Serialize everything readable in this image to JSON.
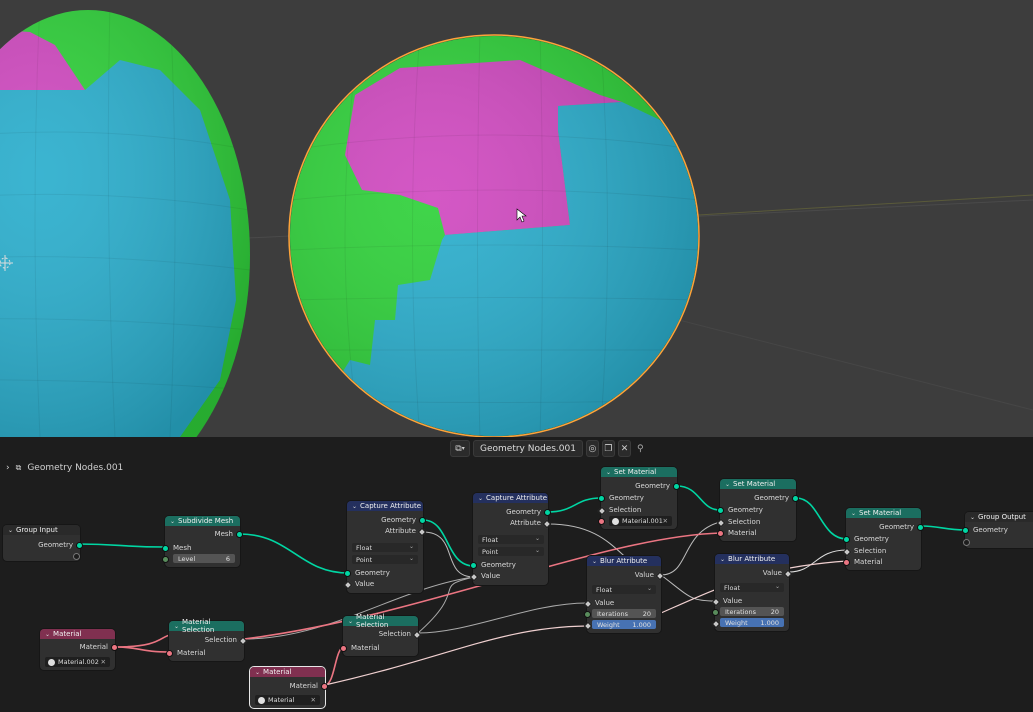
{
  "header": {
    "tree_name": "Geometry Nodes.001"
  },
  "breadcrumb": {
    "label": "Geometry Nodes.001"
  },
  "colors": {
    "geometry_socket": "#00d6a3",
    "material_socket": "#eb7582",
    "float_socket": "#a1a1a1",
    "magenta": "#d049c0",
    "cyan": "#2aaecd",
    "green": "#2fd13a"
  },
  "nodes": {
    "group_input": {
      "title": "Group Input",
      "geometry": "Geometry"
    },
    "subdivide_mesh": {
      "title": "Subdivide Mesh",
      "mesh_out": "Mesh",
      "mesh_in": "Mesh",
      "level_label": "Level",
      "level_value": "6"
    },
    "capture_1": {
      "title": "Capture Attribute",
      "geometry_out": "Geometry",
      "attribute_out": "Attribute",
      "type": "Float",
      "domain": "Point",
      "geometry_in": "Geometry",
      "value_in": "Value"
    },
    "capture_2": {
      "title": "Capture Attribute",
      "geometry_out": "Geometry",
      "attribute_out": "Attribute",
      "type": "Float",
      "domain": "Point",
      "geometry_in": "Geometry",
      "value_in": "Value"
    },
    "set_material_1": {
      "title": "Set Material",
      "geometry_out": "Geometry",
      "geometry_in": "Geometry",
      "selection": "Selection",
      "material": "Material.001"
    },
    "set_material_2": {
      "title": "Set Material",
      "geometry_out": "Geometry",
      "geometry_in": "Geometry",
      "selection": "Selection",
      "material": "Material"
    },
    "set_material_3": {
      "title": "Set Material",
      "geometry_out": "Geometry",
      "geometry_in": "Geometry",
      "selection": "Selection",
      "material": "Material"
    },
    "group_output": {
      "title": "Group Output",
      "geometry": "Geometry"
    },
    "blur_1": {
      "title": "Blur Attribute",
      "value_out": "Value",
      "type": "Float",
      "value_in": "Value",
      "iterations_label": "Iterations",
      "iterations": "20",
      "weight_label": "Weight",
      "weight": "1.000"
    },
    "blur_2": {
      "title": "Blur Attribute",
      "value_out": "Value",
      "type": "Float",
      "value_in": "Value",
      "iterations_label": "Iterations",
      "iterations": "20",
      "weight_label": "Weight",
      "weight": "1.000"
    },
    "material_1": {
      "title": "Material",
      "material_out": "Material",
      "material": "Material.002"
    },
    "material_selection_1": {
      "title": "Material Selection",
      "selection_out": "Selection",
      "material_in": "Material"
    },
    "material_selection_2": {
      "title": "Material Selection",
      "selection_out": "Selection",
      "material_in": "Material"
    },
    "material_2": {
      "title": "Material",
      "material_out": "Material",
      "material": "Material"
    }
  }
}
